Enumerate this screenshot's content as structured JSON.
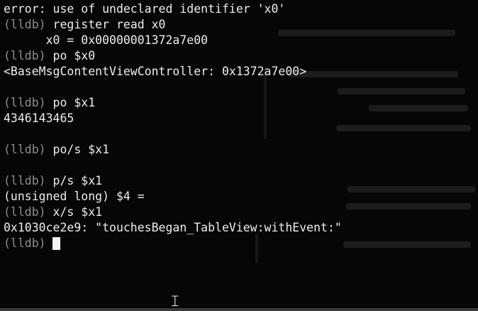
{
  "prompt": "(lldb)",
  "session": [
    {
      "kind": "output",
      "text": "error: use of undeclared identifier 'x0'"
    },
    {
      "kind": "command",
      "prompt": "(lldb)",
      "text": "register read x0"
    },
    {
      "kind": "output",
      "text": "      x0 = 0x00000001372a7e00"
    },
    {
      "kind": "command",
      "prompt": "(lldb)",
      "text": "po $x0"
    },
    {
      "kind": "output",
      "text": "<BaseMsgContentViewController: 0x1372a7e00>"
    },
    {
      "kind": "blank"
    },
    {
      "kind": "command",
      "prompt": "(lldb)",
      "text": "po $x1"
    },
    {
      "kind": "output",
      "text": "4346143465"
    },
    {
      "kind": "blank"
    },
    {
      "kind": "command",
      "prompt": "(lldb)",
      "text": "po/s $x1"
    },
    {
      "kind": "blank"
    },
    {
      "kind": "command",
      "prompt": "(lldb)",
      "text": "p/s $x1"
    },
    {
      "kind": "output",
      "text": "(unsigned long) $4 ="
    },
    {
      "kind": "command",
      "prompt": "(lldb)",
      "text": "x/s $x1"
    },
    {
      "kind": "output",
      "text": "0x1030ce2e9: \"touchesBegan_TableView:withEvent:\""
    },
    {
      "kind": "input",
      "prompt": "(lldb)",
      "text": ""
    }
  ],
  "colors": {
    "background": "#060606",
    "text": "#ededed",
    "prompt": "#8d8d8d",
    "cursor": "#f4f4f4"
  },
  "icons": {
    "mouse_pointer": "text-cursor-ibeam-icon"
  }
}
